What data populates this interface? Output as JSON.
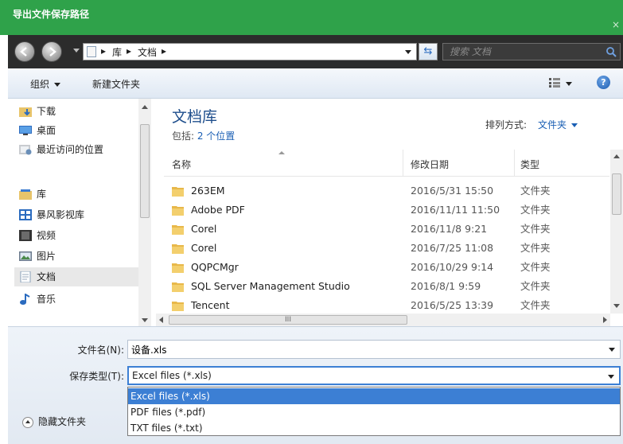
{
  "window": {
    "title": "导出文件保存路径",
    "close_glyph": "×"
  },
  "address": {
    "crumbs": [
      "库",
      "文档"
    ],
    "search_placeholder": "搜索 文档"
  },
  "toolbar": {
    "organize": "组织",
    "new_folder": "新建文件夹",
    "help_glyph": "?"
  },
  "nav": {
    "items": [
      {
        "label": "下载",
        "icon": "download-folder-icon"
      },
      {
        "label": "桌面",
        "icon": "desktop-icon"
      },
      {
        "label": "最近访问的位置",
        "icon": "recent-places-icon"
      },
      {
        "label": "库",
        "icon": "library-icon"
      },
      {
        "label": "暴风影视库",
        "icon": "video-library-icon"
      },
      {
        "label": "视频",
        "icon": "video-icon"
      },
      {
        "label": "图片",
        "icon": "pictures-icon"
      },
      {
        "label": "文档",
        "icon": "documents-icon",
        "selected": true
      },
      {
        "label": "音乐",
        "icon": "music-icon"
      }
    ]
  },
  "library": {
    "title": "文档库",
    "includes_prefix": "包括: ",
    "includes_link": "2 个位置",
    "sort_label": "排列方式:",
    "sort_value": "文件夹"
  },
  "columns": {
    "name": "名称",
    "modified": "修改日期",
    "type": "类型"
  },
  "files": [
    {
      "name": "263EM",
      "modified": "2016/5/31 15:50",
      "type": "文件夹"
    },
    {
      "name": "Adobe PDF",
      "modified": "2016/11/11 11:50",
      "type": "文件夹"
    },
    {
      "name": "Corel",
      "modified": "2016/11/8 9:21",
      "type": "文件夹"
    },
    {
      "name": "Corel",
      "modified": "2016/7/25 11:08",
      "type": "文件夹"
    },
    {
      "name": "QQPCMgr",
      "modified": "2016/10/29 9:14",
      "type": "文件夹"
    },
    {
      "name": "SQL Server Management Studio",
      "modified": "2016/8/1 9:59",
      "type": "文件夹"
    },
    {
      "name": "Tencent",
      "modified": "2016/5/25 13:39",
      "type": "文件夹"
    }
  ],
  "hscroll_glyph": "III",
  "form": {
    "filename_label": "文件名(N):",
    "filename_value": "设备.xls",
    "type_label": "保存类型(T):",
    "type_value": "Excel files (*.xls)",
    "type_options": [
      "Excel files (*.xls)",
      "PDF files (*.pdf)",
      "TXT files (*.txt)"
    ],
    "hide_folders": "隐藏文件夹"
  },
  "colors": {
    "titlebar": "#2fa24a",
    "address_bg": "#2c2c2c",
    "link": "#1a5fb4",
    "selection": "#3c7fd4"
  }
}
